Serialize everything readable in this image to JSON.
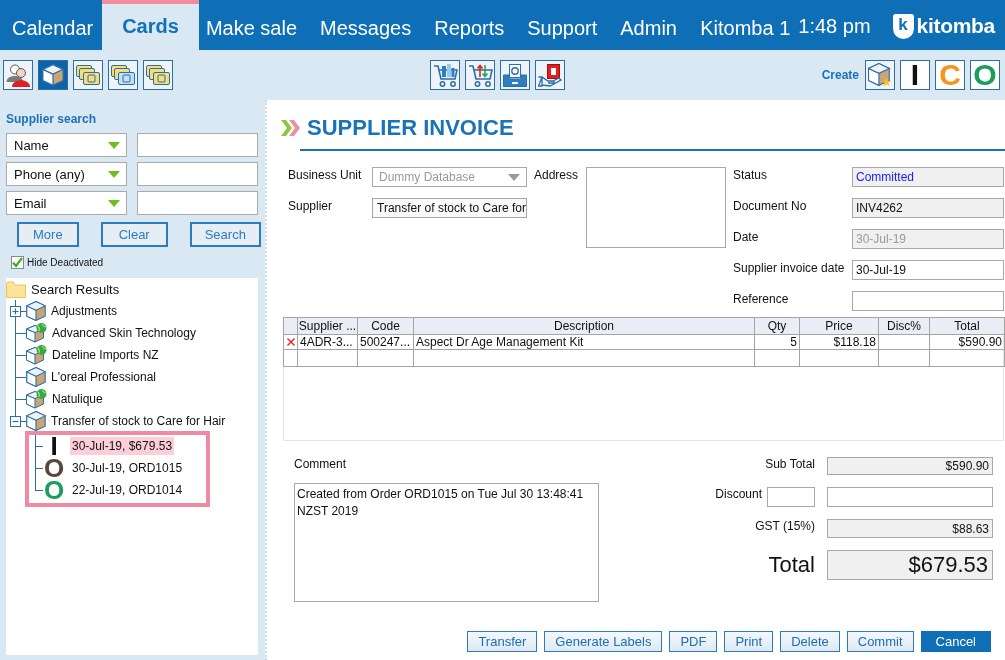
{
  "nav": {
    "tabs": [
      {
        "label": "Calendar",
        "selected": false
      },
      {
        "label": "Cards",
        "selected": true
      },
      {
        "label": "Make sale",
        "selected": false
      },
      {
        "label": "Messages",
        "selected": false
      },
      {
        "label": "Reports",
        "selected": false
      },
      {
        "label": "Support",
        "selected": false
      },
      {
        "label": "Admin",
        "selected": false
      }
    ],
    "account": "Kitomba 1",
    "time": "1:48 pm",
    "logo": {
      "mark": "k",
      "name": "kitomba"
    }
  },
  "toolbar": {
    "left": [
      {
        "selected": false
      },
      {
        "selected": true
      },
      {
        "selected": false
      },
      {
        "selected": false
      },
      {
        "selected": false
      }
    ],
    "create": {
      "label": "Create",
      "items": [
        {
          "kind": "box"
        },
        {
          "kind": "letter",
          "letter": "I",
          "color": "#111111"
        },
        {
          "kind": "letter",
          "letter": "C",
          "color": "#f7941d"
        },
        {
          "kind": "letter",
          "letter": "O",
          "color": "#1b9e5a"
        }
      ]
    }
  },
  "search": {
    "title": "Supplier search",
    "filters": [
      {
        "field": "Name"
      },
      {
        "field": "Phone (any)"
      },
      {
        "field": "Email"
      }
    ],
    "buttons": [
      "More",
      "Clear",
      "Search"
    ],
    "hide_deactivated": {
      "label": "Hide Deactivated",
      "checked": true
    }
  },
  "results": {
    "root": "Search Results",
    "items": [
      {
        "label": "Adjustments",
        "kind": "plain",
        "expandable": true,
        "expanded": false
      },
      {
        "label": "Advanced Skin Technology",
        "kind": "globe",
        "expandable": false,
        "expanded": false
      },
      {
        "label": "Dateline Imports NZ",
        "kind": "globe",
        "expandable": false,
        "expanded": false
      },
      {
        "label": "L'oreal Professional",
        "kind": "plain",
        "expandable": false,
        "expanded": false
      },
      {
        "label": "Natulique",
        "kind": "globe",
        "expandable": false,
        "expanded": false
      },
      {
        "label": "Transfer of stock to Care for Hair",
        "kind": "plain",
        "expandable": true,
        "expanded": true,
        "children": [
          {
            "marker": "I",
            "color": "#111111",
            "label": "30-Jul-19, $679.53",
            "selected": true
          },
          {
            "marker": "O",
            "color": "#5a4636",
            "label": "30-Jul-19, ORD1015",
            "selected": false
          },
          {
            "marker": "O",
            "color": "#1b9e5a",
            "label": "22-Jul-19, ORD1014",
            "selected": false
          }
        ]
      }
    ]
  },
  "invoice": {
    "title": "SUPPLIER INVOICE",
    "business_unit": {
      "label": "Business Unit",
      "value": "Dummy Database",
      "disabled": true
    },
    "supplier": {
      "label": "Supplier",
      "value": "Transfer of stock to Care for"
    },
    "address": {
      "label": "Address"
    },
    "details": [
      {
        "label": "Status",
        "value": "Committed",
        "kind": "status"
      },
      {
        "label": "Document No",
        "value": "INV4262",
        "kind": "readonly"
      },
      {
        "label": "Date",
        "value": "30-Jul-19",
        "kind": "disabled"
      },
      {
        "label": "Supplier invoice date",
        "value": "30-Jul-19",
        "kind": "editable"
      },
      {
        "label": "Reference",
        "kind": "editable"
      }
    ],
    "lines": {
      "columns": [
        "Supplier ...",
        "Code",
        "Description",
        "Qty",
        "Price",
        "Disc%",
        "Total"
      ],
      "rows": [
        {
          "supplier_code": "4ADR-3...",
          "code": "500247...",
          "description": "Aspect Dr Age Management Kit",
          "qty": "5",
          "price": "$118.18",
          "total": "$590.90"
        }
      ]
    },
    "comment": {
      "label": "Comment",
      "value": "Created from Order ORD1015 on Tue Jul 30 13:48:41 NZST 2019"
    },
    "totals": {
      "subtotal": {
        "label": "Sub Total",
        "value": "$590.90"
      },
      "discount": {
        "label": "Discount"
      },
      "gst": {
        "label": "GST (15%)",
        "value": "$88.63"
      },
      "total": {
        "label": "Total",
        "value": "$679.53"
      }
    },
    "actions": [
      {
        "label": "Transfer",
        "primary": false
      },
      {
        "label": "Generate Labels",
        "primary": false
      },
      {
        "label": "PDF",
        "primary": false
      },
      {
        "label": "Print",
        "primary": false
      },
      {
        "label": "Delete",
        "primary": false
      },
      {
        "label": "Commit",
        "primary": false
      },
      {
        "label": "Cancel",
        "primary": true
      }
    ]
  }
}
